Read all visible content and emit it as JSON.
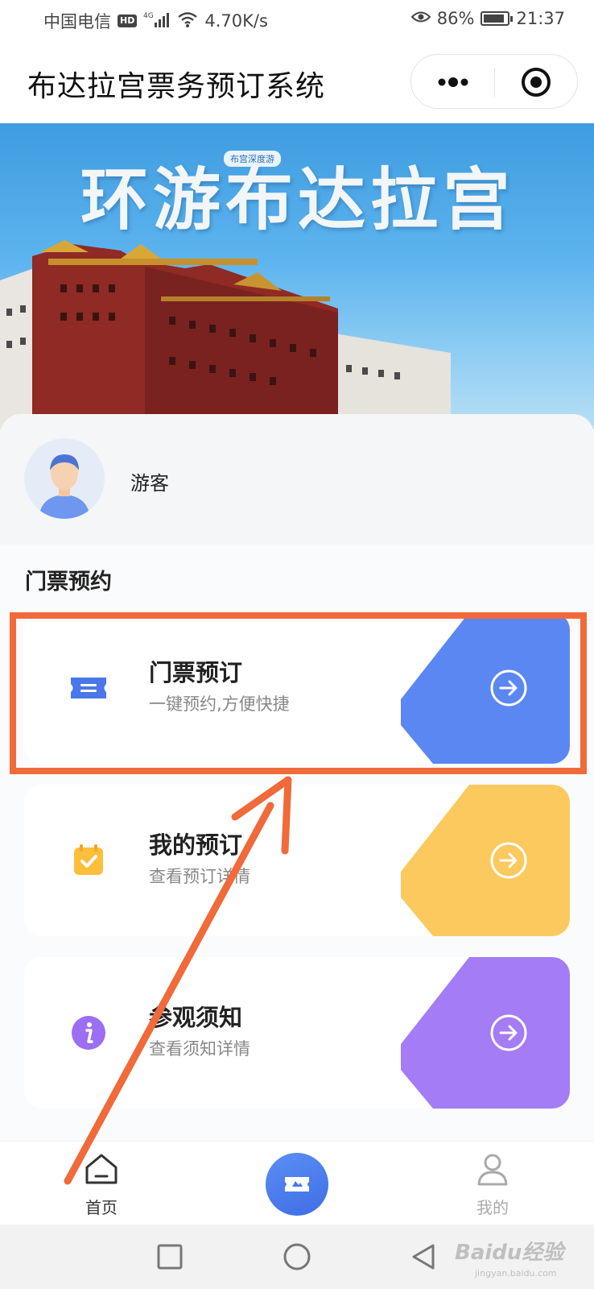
{
  "status_bar": {
    "carrier": "中国电信",
    "hd_badge": "HD",
    "network_type": "4G",
    "speed": "4.70K/s",
    "battery": "86%",
    "battery_level": 0.86,
    "time": "21:37"
  },
  "nav_bar": {
    "title": "布达拉宫票务预订系统"
  },
  "banner": {
    "title": "环游布达拉宫",
    "tag": "布宫深度游"
  },
  "user": {
    "name": "游客"
  },
  "section": {
    "title": "门票预约"
  },
  "cards": [
    {
      "title": "门票预订",
      "subtitle": "一键预约,方便快捷",
      "icon": "ticket-icon",
      "accent": "#5b87f2",
      "circle": "#e6edfb"
    },
    {
      "title": "我的预订",
      "subtitle": "查看预订详情",
      "icon": "checklist-icon",
      "accent": "#fbc95e",
      "circle": "#fff3df"
    },
    {
      "title": "参观须知",
      "subtitle": "查看须知详情",
      "icon": "info-icon",
      "accent": "#a47cf5",
      "circle": "#f0e8fd"
    }
  ],
  "tab_bar": {
    "home_label": "首页",
    "center_icon": "ticket-icon",
    "mine_label": "我的",
    "active_color": "#333333",
    "inactive_color": "#aaaaaa"
  },
  "system_nav": {
    "watermark": "Baidu经验",
    "watermark_sub": "jingyan.baidu.com"
  }
}
